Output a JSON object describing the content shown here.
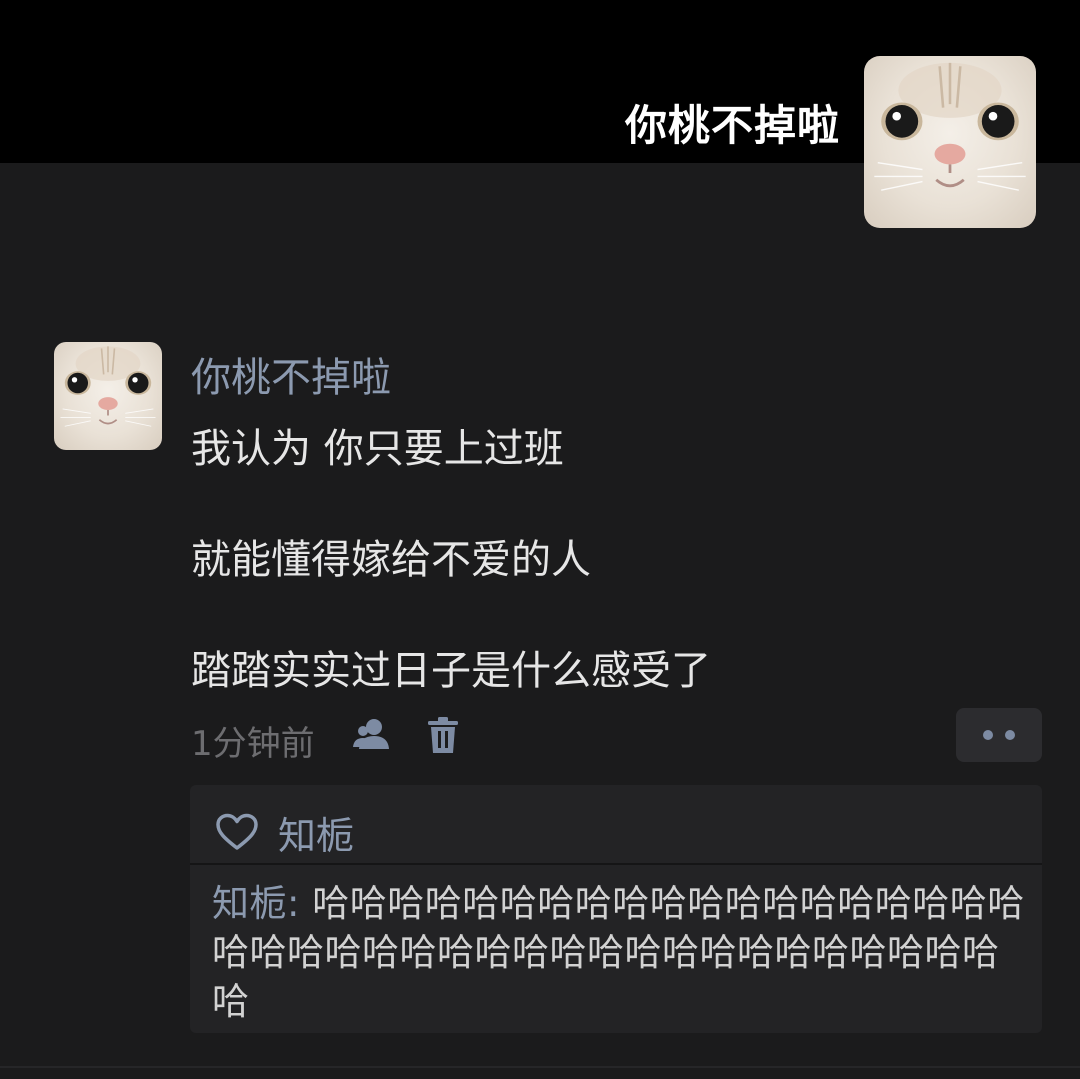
{
  "header": {
    "name": "你桃不掉啦",
    "avatar_icon": "cat-avatar-icon"
  },
  "comment": {
    "author": "你桃不掉啦",
    "avatar_icon": "cat-avatar-icon",
    "lines": [
      "我认为  你只要上过班",
      "就能懂得嫁给不爱的人",
      "踏踏实实过日子是什么感受了"
    ],
    "time": "1分钟前",
    "actions": {
      "user_icon": "user-icon",
      "delete_icon": "trash-icon",
      "more_icon": "more-dots-icon"
    }
  },
  "reply_box": {
    "like_icon": "heart-icon",
    "like_user": "知栀",
    "reply": {
      "author": "知栀",
      "separator": ": ",
      "text": "哈哈哈哈哈哈哈哈哈哈哈哈哈哈哈哈哈哈哈哈哈哈哈哈哈哈哈哈哈哈哈哈哈哈哈哈哈哈哈哈哈"
    }
  },
  "colors": {
    "background": "#1b1b1c",
    "top_band": "#000000",
    "name_blue": "#8c9ab0",
    "text": "#e6e6e6",
    "meta": "#6d6d70",
    "reply_bg": "#232325"
  }
}
